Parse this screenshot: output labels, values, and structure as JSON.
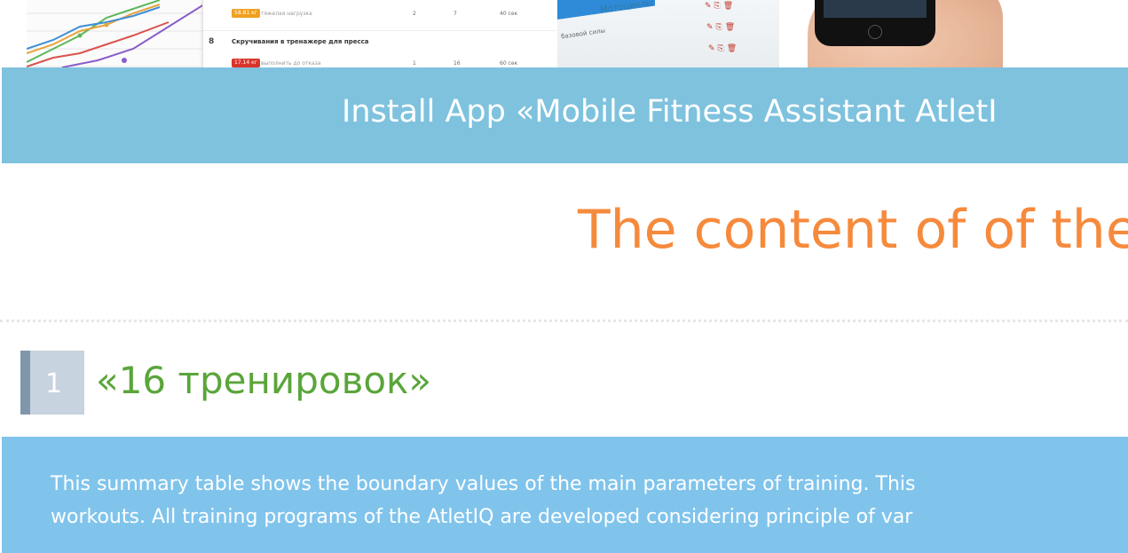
{
  "hero": {
    "table_rows": [
      {
        "badge": "58.81 кг",
        "note": "тяжелая нагрузка",
        "sets": "2",
        "reps": "7",
        "rest": "40 сек"
      },
      {
        "num": "8",
        "title": "Скручивания в тренажере для пресса"
      },
      {
        "badge": "17.14 кг",
        "note": "выполнить до отказа",
        "sets": "1",
        "reps": "16",
        "rest": "60 сек"
      }
    ],
    "list_title": "Мотоциклы",
    "list_item": "базовой силы",
    "colors": {
      "badge_orange": "#f0a020",
      "badge_red": "#d9342b",
      "phone": "#111111"
    }
  },
  "banner": {
    "text": "Install App «Mobile Fitness Assistant AtletI"
  },
  "section": {
    "title": "The content of of the"
  },
  "item": {
    "number": "1",
    "title": "«16 тренировок»"
  },
  "description": {
    "line1": "This summary table shows the boundary values of the main parameters of training. This",
    "line2": "workouts. All training programs of the AtletIQ are developed considering principle of var"
  },
  "colors": {
    "banner_bg": "#7ec2de",
    "section_title": "#f68a3c",
    "item_title": "#5aa53a",
    "desc_bg": "#80c4ec"
  }
}
